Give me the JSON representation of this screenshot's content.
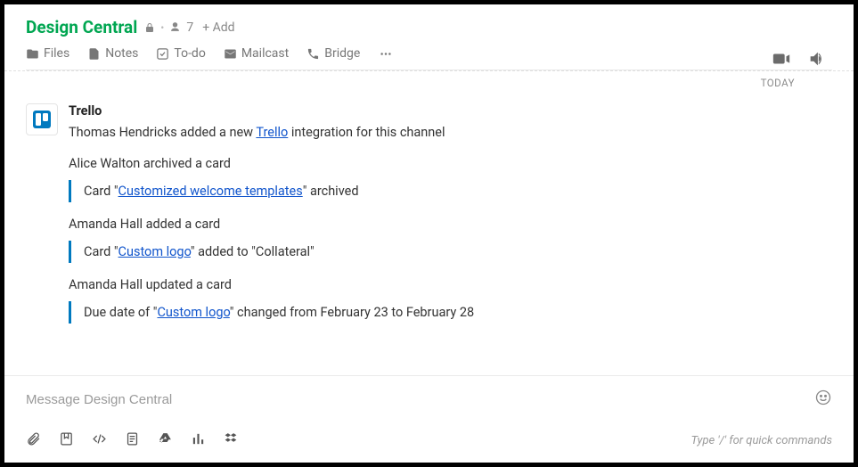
{
  "header": {
    "channel_name": "Design Central",
    "member_count": "7",
    "add_label": "+ Add"
  },
  "tabs": {
    "files": "Files",
    "notes": "Notes",
    "todo": "To-do",
    "mailcast": "Mailcast",
    "bridge": "Bridge"
  },
  "date_label": "TODAY",
  "app": {
    "name": "Trello"
  },
  "events": {
    "intro_prefix": "Thomas Hendricks added a new ",
    "intro_link": "Trello",
    "intro_suffix": " integration for this channel",
    "e1_activity": "Alice Walton archived a card",
    "e1_detail_prefix": "Card \"",
    "e1_detail_link": "Customized welcome templates",
    "e1_detail_suffix": "\" archived",
    "e2_activity": "Amanda Hall added a card",
    "e2_detail_prefix": "Card \"",
    "e2_detail_link": "Custom logo",
    "e2_detail_suffix": "\" added to \"Collateral\"",
    "e3_activity": "Amanda Hall updated a card",
    "e3_detail_prefix": "Due date of \"",
    "e3_detail_link": "Custom logo",
    "e3_detail_suffix": "\" changed from February 23 to February 28"
  },
  "composer": {
    "placeholder": "Message Design Central",
    "hint": "Type '/' for quick commands"
  }
}
